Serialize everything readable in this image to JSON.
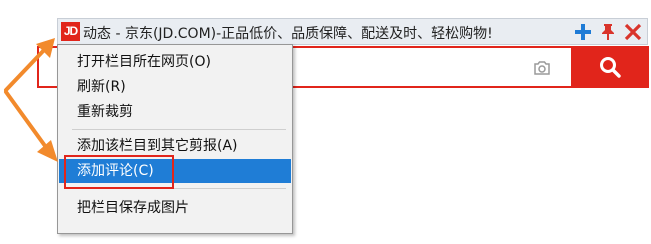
{
  "titlebar": {
    "logo_text": "JD",
    "title": "动态 - 京东(JD.COM)-正品低价、品质保障、配送及时、轻松购物!",
    "icons": [
      "add-icon",
      "pin-icon",
      "close-icon"
    ],
    "accent_add": "#1e7bd6",
    "accent_close": "#d9342b"
  },
  "search": {
    "placeholder": "",
    "icons": [
      "camera-icon",
      "search-icon"
    ],
    "brand_color": "#e1251b"
  },
  "menu": {
    "items": [
      {
        "label": "打开栏目所在网页(O)"
      },
      {
        "label": "刷新(R)"
      },
      {
        "label": "重新裁剪"
      },
      {
        "label": "添加该栏目到其它剪报(A)"
      },
      {
        "label": "添加评论(C)",
        "selected": true
      },
      {
        "label": "把栏目保存成图片"
      }
    ],
    "selected_color": "#1f7dd6"
  },
  "annotation": {
    "arrow_color": "#f28a2c",
    "box_color": "#e1251b"
  }
}
